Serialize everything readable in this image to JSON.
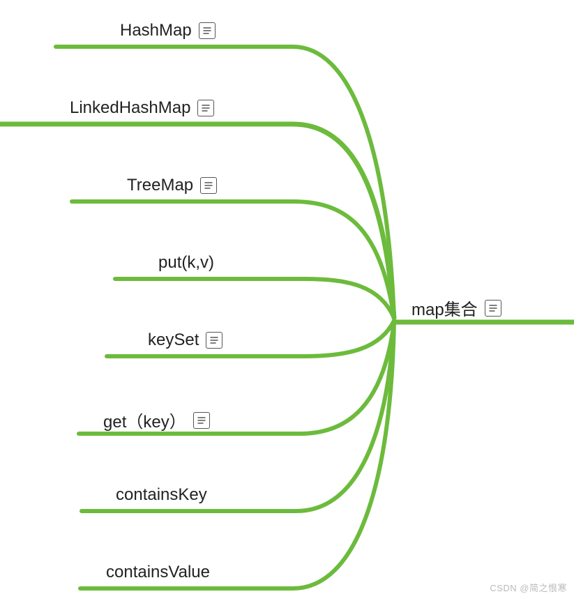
{
  "root": {
    "label": "map集合",
    "has_note": true
  },
  "children": [
    {
      "label": "HashMap",
      "has_note": true
    },
    {
      "label": "LinkedHashMap",
      "has_note": true
    },
    {
      "label": "TreeMap",
      "has_note": true
    },
    {
      "label": "put(k,v)",
      "has_note": false
    },
    {
      "label": "keySet",
      "has_note": true
    },
    {
      "label": "get（key）",
      "has_note": true
    },
    {
      "label": "containsKey",
      "has_note": false
    },
    {
      "label": "containsValue",
      "has_note": false
    }
  ],
  "watermark": "CSDN @简之恨寒",
  "colors": {
    "stroke": "#6cbb3c",
    "stroke_light": "#7fc84e"
  }
}
